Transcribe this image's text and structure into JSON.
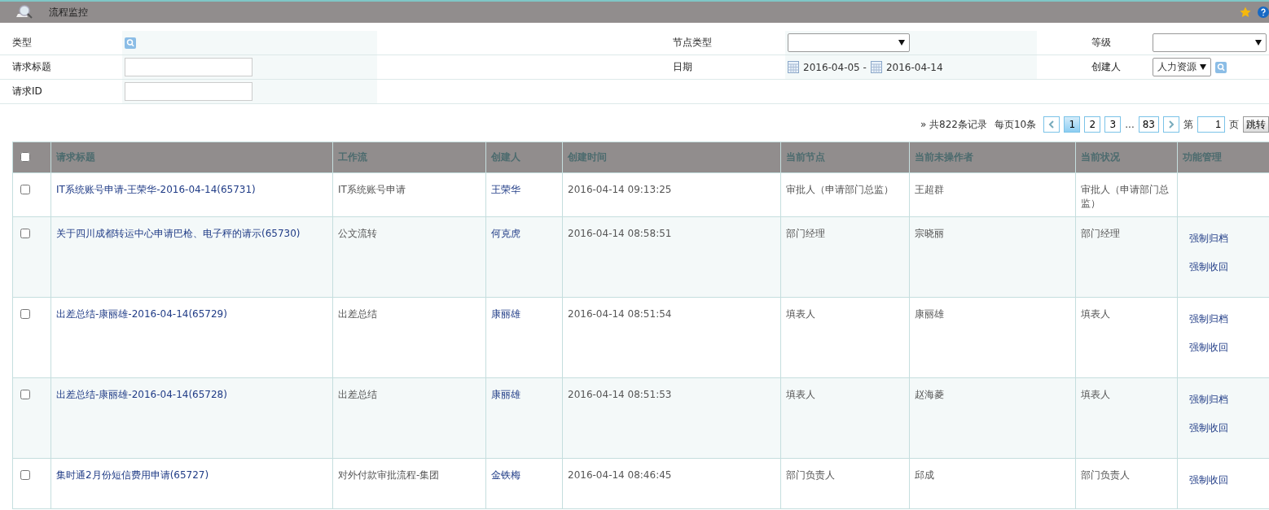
{
  "window": {
    "title": "流程监控"
  },
  "filters": [
    [
      {
        "label": "类型",
        "kind": "lookup"
      },
      {
        "label": "节点类型",
        "kind": "select"
      },
      {
        "label": "等级",
        "kind": "select"
      }
    ],
    [
      {
        "label": "请求标题",
        "kind": "text"
      },
      {
        "label": "日期",
        "kind": "daterange",
        "from": "2016-04-05 -",
        "to": "2016-04-14"
      },
      {
        "label": "创建人",
        "kind": "selectlookup",
        "value": "人力资源"
      }
    ],
    [
      {
        "label": "请求ID",
        "kind": "text"
      }
    ]
  ],
  "pager": {
    "total": "» 共822条记录",
    "per_page": "每页10条",
    "pages": [
      {
        "label": "1",
        "selected": true
      },
      {
        "label": "2",
        "selected": false
      },
      {
        "label": "3",
        "selected": false
      },
      {
        "label": "...",
        "kind": "gap",
        "selected": false
      },
      {
        "label": "83",
        "selected": false
      }
    ],
    "page_label": "第",
    "page_value": "1",
    "page_suffix": "页",
    "jump": "跳转"
  },
  "table": {
    "all_checked": false,
    "columns": [
      "请求标题",
      "工作流",
      "创建人",
      "创建时间",
      "当前节点",
      "当前未操作者",
      "当前状况",
      "功能管理"
    ],
    "rows": [
      {
        "checked": false,
        "title": "IT系统账号申请-王荣华-2016-04-14(65731)",
        "workflow": "IT系统账号申请",
        "creator": "王荣华",
        "time": "2016-04-14 09:13:25",
        "node": "审批人（申请部门总监）",
        "operator": "王超群",
        "status": "审批人（申请部门总监）",
        "actions": []
      },
      {
        "checked": false,
        "title": "关于四川成都转运中心申请巴枪、电子秤的请示(65730)",
        "workflow": "公文流转",
        "creator": "何克虎",
        "time": "2016-04-14 08:58:51",
        "node": "部门经理",
        "operator": "宗晓丽",
        "status": "部门经理",
        "actions": [
          "强制归档",
          "强制收回"
        ]
      },
      {
        "checked": false,
        "title": "出差总结-康丽雄-2016-04-14(65729)",
        "workflow": "出差总结",
        "creator": "康丽雄",
        "time": "2016-04-14 08:51:54",
        "node": "填表人",
        "operator": "康丽雄",
        "status": "填表人",
        "actions": [
          "强制归档",
          "强制收回"
        ]
      },
      {
        "checked": false,
        "title": "出差总结-康丽雄-2016-04-14(65728)",
        "workflow": "出差总结",
        "creator": "康丽雄",
        "time": "2016-04-14 08:51:53",
        "node": "填表人",
        "operator": "赵海菱",
        "status": "填表人",
        "actions": [
          "强制归档",
          "强制收回"
        ]
      },
      {
        "checked": false,
        "title": "集时通2月份短信费用申请(65727)",
        "workflow": "对外付款审批流程-集团",
        "creator": "金铁梅",
        "time": "2016-04-14 08:46:45",
        "node": "部门负责人",
        "operator": "邱成",
        "status": "部门负责人",
        "actions": [
          "强制收回"
        ]
      }
    ]
  }
}
